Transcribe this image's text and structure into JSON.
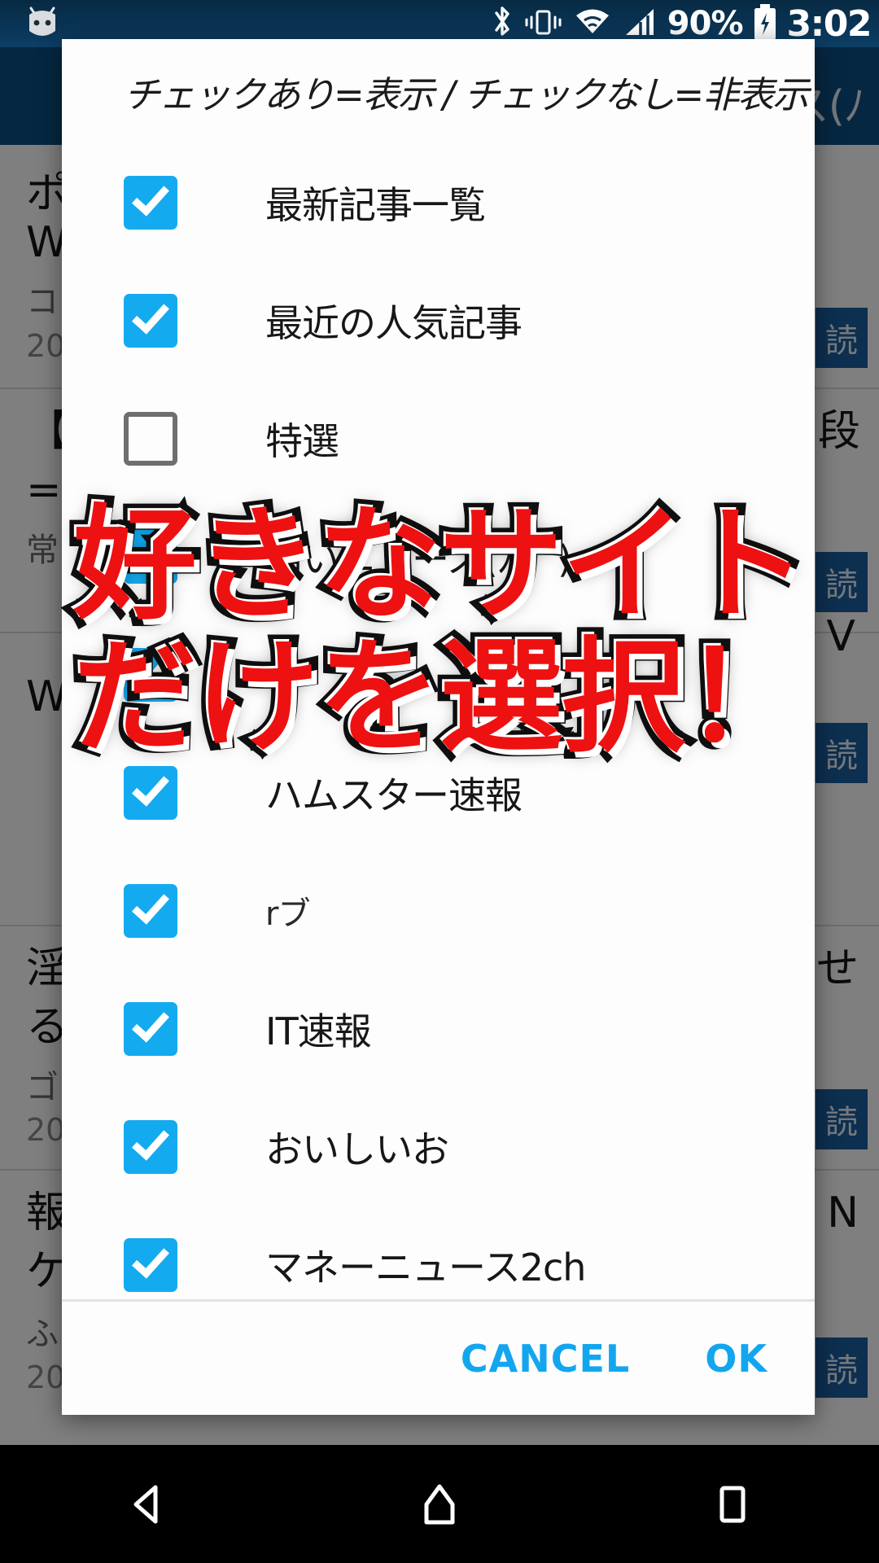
{
  "status_bar": {
    "icons": [
      "android-robot-icon",
      "bluetooth-icon",
      "vibrate-icon",
      "wifi-icon",
      "signal-icon"
    ],
    "battery_percent": "90%",
    "battery_state_icon": "battery-charging-icon",
    "clock": "3:02"
  },
  "background_app": {
    "app_bar_title": "ス(ﾉ",
    "app_bar_color": "#0d4f82",
    "badge_label": "読",
    "rows": [
      {
        "title": "ポ",
        "sub1": "W",
        "sub2": "コ",
        "date": "20",
        "badge": "読"
      },
      {
        "title": "【",
        "sub1": "=",
        "sub2": "常",
        "date": "",
        "badge": "読",
        "right_text": "段"
      },
      {
        "title": "",
        "sub1": "W",
        "sub2": "",
        "date": "",
        "badge": "読",
        "right_text": "V"
      },
      {
        "title": "淫",
        "sub1": "る",
        "sub2": "ゴ",
        "date": "20",
        "badge": "読",
        "right_text": "せ"
      },
      {
        "title": "報",
        "sub1": "ケ",
        "sub2": "ふ",
        "date": "20",
        "badge": "読",
        "right_text": "N"
      }
    ]
  },
  "dialog": {
    "title": "チェックあり=表示 / チェックなし=非表示",
    "options": [
      {
        "label": "最新記事一覧",
        "checked": true
      },
      {
        "label": "最近の人気記事",
        "checked": true
      },
      {
        "label": "特選",
        "checked": false
      },
      {
        "label": "痛いニュース(ﾉ∀`)",
        "checked": true
      },
      {
        "label": "",
        "checked": true
      },
      {
        "label": "ハムスター速報",
        "checked": true
      },
      {
        "label": "rブ",
        "checked": true
      },
      {
        "label": "IT速報",
        "checked": true
      },
      {
        "label": "おいしいお",
        "checked": true
      },
      {
        "label": "マネーニュース2ch",
        "checked": true
      }
    ],
    "cancel_label": "CANCEL",
    "ok_label": "OK",
    "accent_color": "#13a6ef",
    "checkbox_color": "#14aaf0"
  },
  "overlay_caption": {
    "line1": "好きなサイト",
    "line2": "だけを選択！",
    "text_color": "#ee1111",
    "outline_color": "#111111"
  },
  "nav_bar": {
    "back_icon": "back-triangle-icon",
    "home_icon": "home-icon",
    "recents_icon": "recents-square-icon"
  }
}
